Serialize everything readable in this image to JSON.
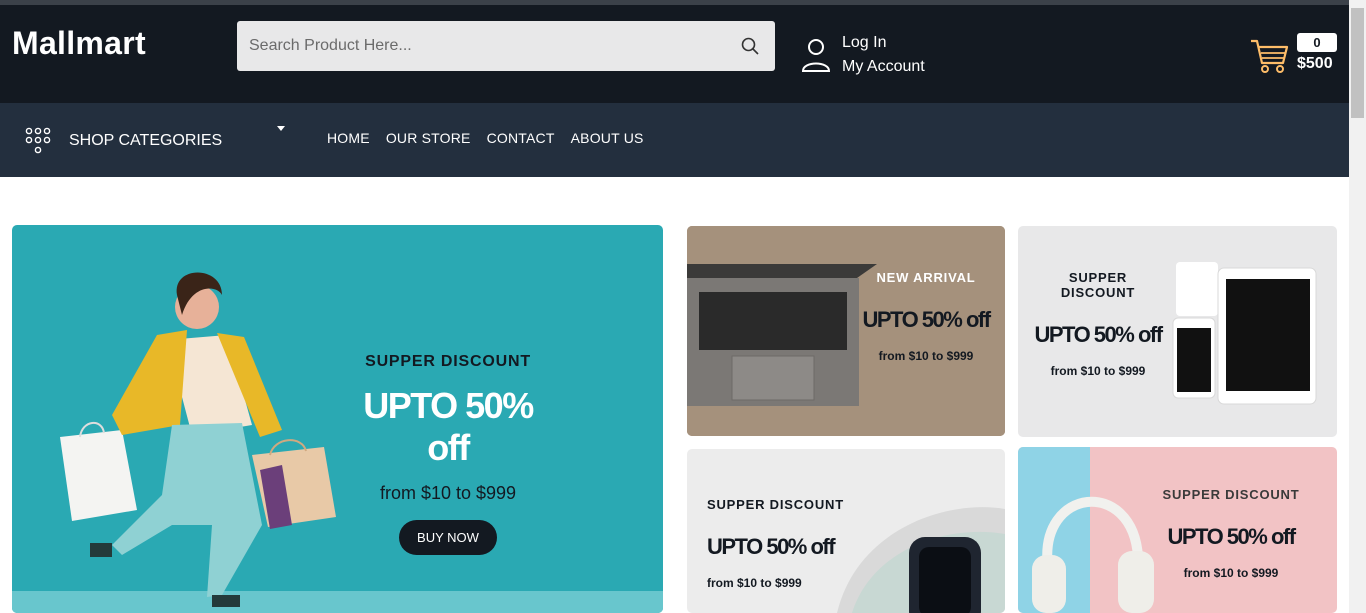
{
  "header": {
    "logo": "Mallmart",
    "search_placeholder": "Search Product Here...",
    "account_line1": "Log In",
    "account_line2": "My Account",
    "cart_count": "0",
    "cart_total": "$500"
  },
  "nav": {
    "categories_label": "SHOP CATEGORIES",
    "links": [
      "HOME",
      "OUR STORE",
      "CONTACT",
      "ABOUT US"
    ]
  },
  "main_banner": {
    "eyebrow": "SUPPER DISCOUNT",
    "headline": "UPTO 50% off",
    "subtitle": "from $10 to $999",
    "button": "BUY NOW"
  },
  "small_banners": [
    {
      "eyebrow": "NEW ARRIVAL",
      "headline": "UPTO 50% off",
      "subtitle": "from $10 to $999"
    },
    {
      "eyebrow": "SUPPER DISCOUNT",
      "headline": "UPTO 50% off",
      "subtitle": "from $10 to $999"
    },
    {
      "eyebrow": "SUPPER DISCOUNT",
      "headline": "UPTO 50% off",
      "subtitle": "from $10 to $999"
    },
    {
      "eyebrow": "SUPPER DISCOUNT",
      "headline": "UPTO 50% off",
      "subtitle": "from $10 to $999"
    }
  ],
  "icons": {
    "search": "search-icon",
    "user": "user-icon",
    "cart": "cart-icon",
    "categories": "grid-dots-icon",
    "caret": "caret-down-icon"
  },
  "colors": {
    "header_bg": "#131921",
    "nav_bg": "#232f3e",
    "main_banner_bg": "#2aa9b3",
    "accent_orange": "#febd69"
  }
}
